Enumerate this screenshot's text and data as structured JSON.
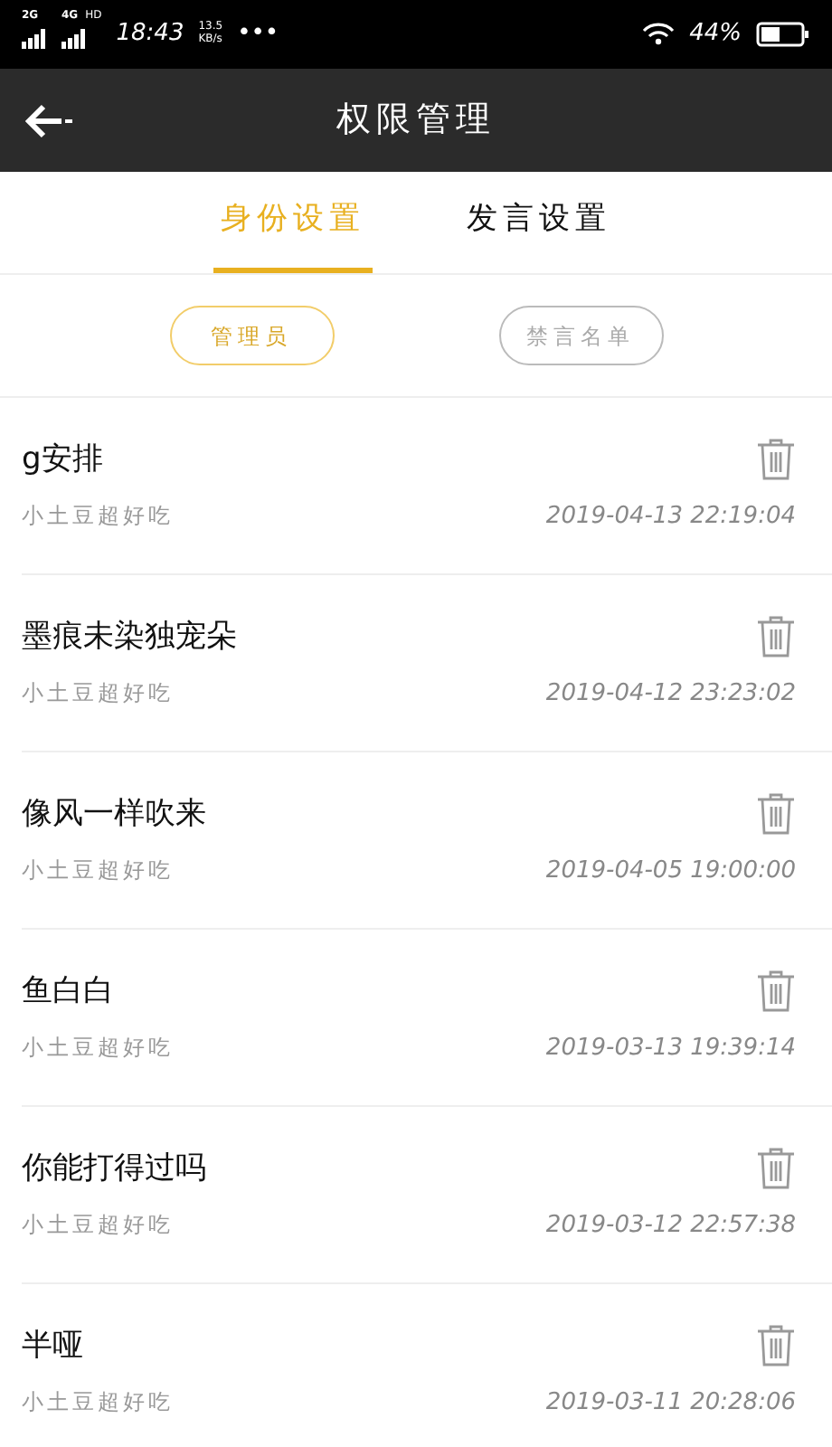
{
  "status_bar": {
    "network_1": "2G",
    "network_2": "4G",
    "network_2_badge": "HD",
    "time": "18:43",
    "speed_value": "13.5",
    "speed_unit": "KB/s",
    "more": "•••",
    "battery": "44%"
  },
  "header": {
    "title": "权限管理"
  },
  "tabs": [
    {
      "label": "身份设置",
      "selected": true
    },
    {
      "label": "发言设置",
      "selected": false
    }
  ],
  "filters": [
    {
      "label": "管理员",
      "selected": true
    },
    {
      "label": "禁言名单",
      "selected": false
    }
  ],
  "members": [
    {
      "name": "g安排",
      "group": "小土豆超好吃",
      "time": "2019-04-13 22:19:04"
    },
    {
      "name": "墨痕未染独宠朵",
      "group": "小土豆超好吃",
      "time": "2019-04-12 23:23:02"
    },
    {
      "name": "像风一样吹来",
      "group": "小土豆超好吃",
      "time": "2019-04-05 19:00:00"
    },
    {
      "name": "鱼白白",
      "group": "小土豆超好吃",
      "time": "2019-03-13 19:39:14"
    },
    {
      "name": "你能打得过吗",
      "group": "小土豆超好吃",
      "time": "2019-03-12 22:57:38"
    },
    {
      "name": "半哑",
      "group": "小土豆超好吃",
      "time": "2019-03-11 20:28:06"
    }
  ]
}
